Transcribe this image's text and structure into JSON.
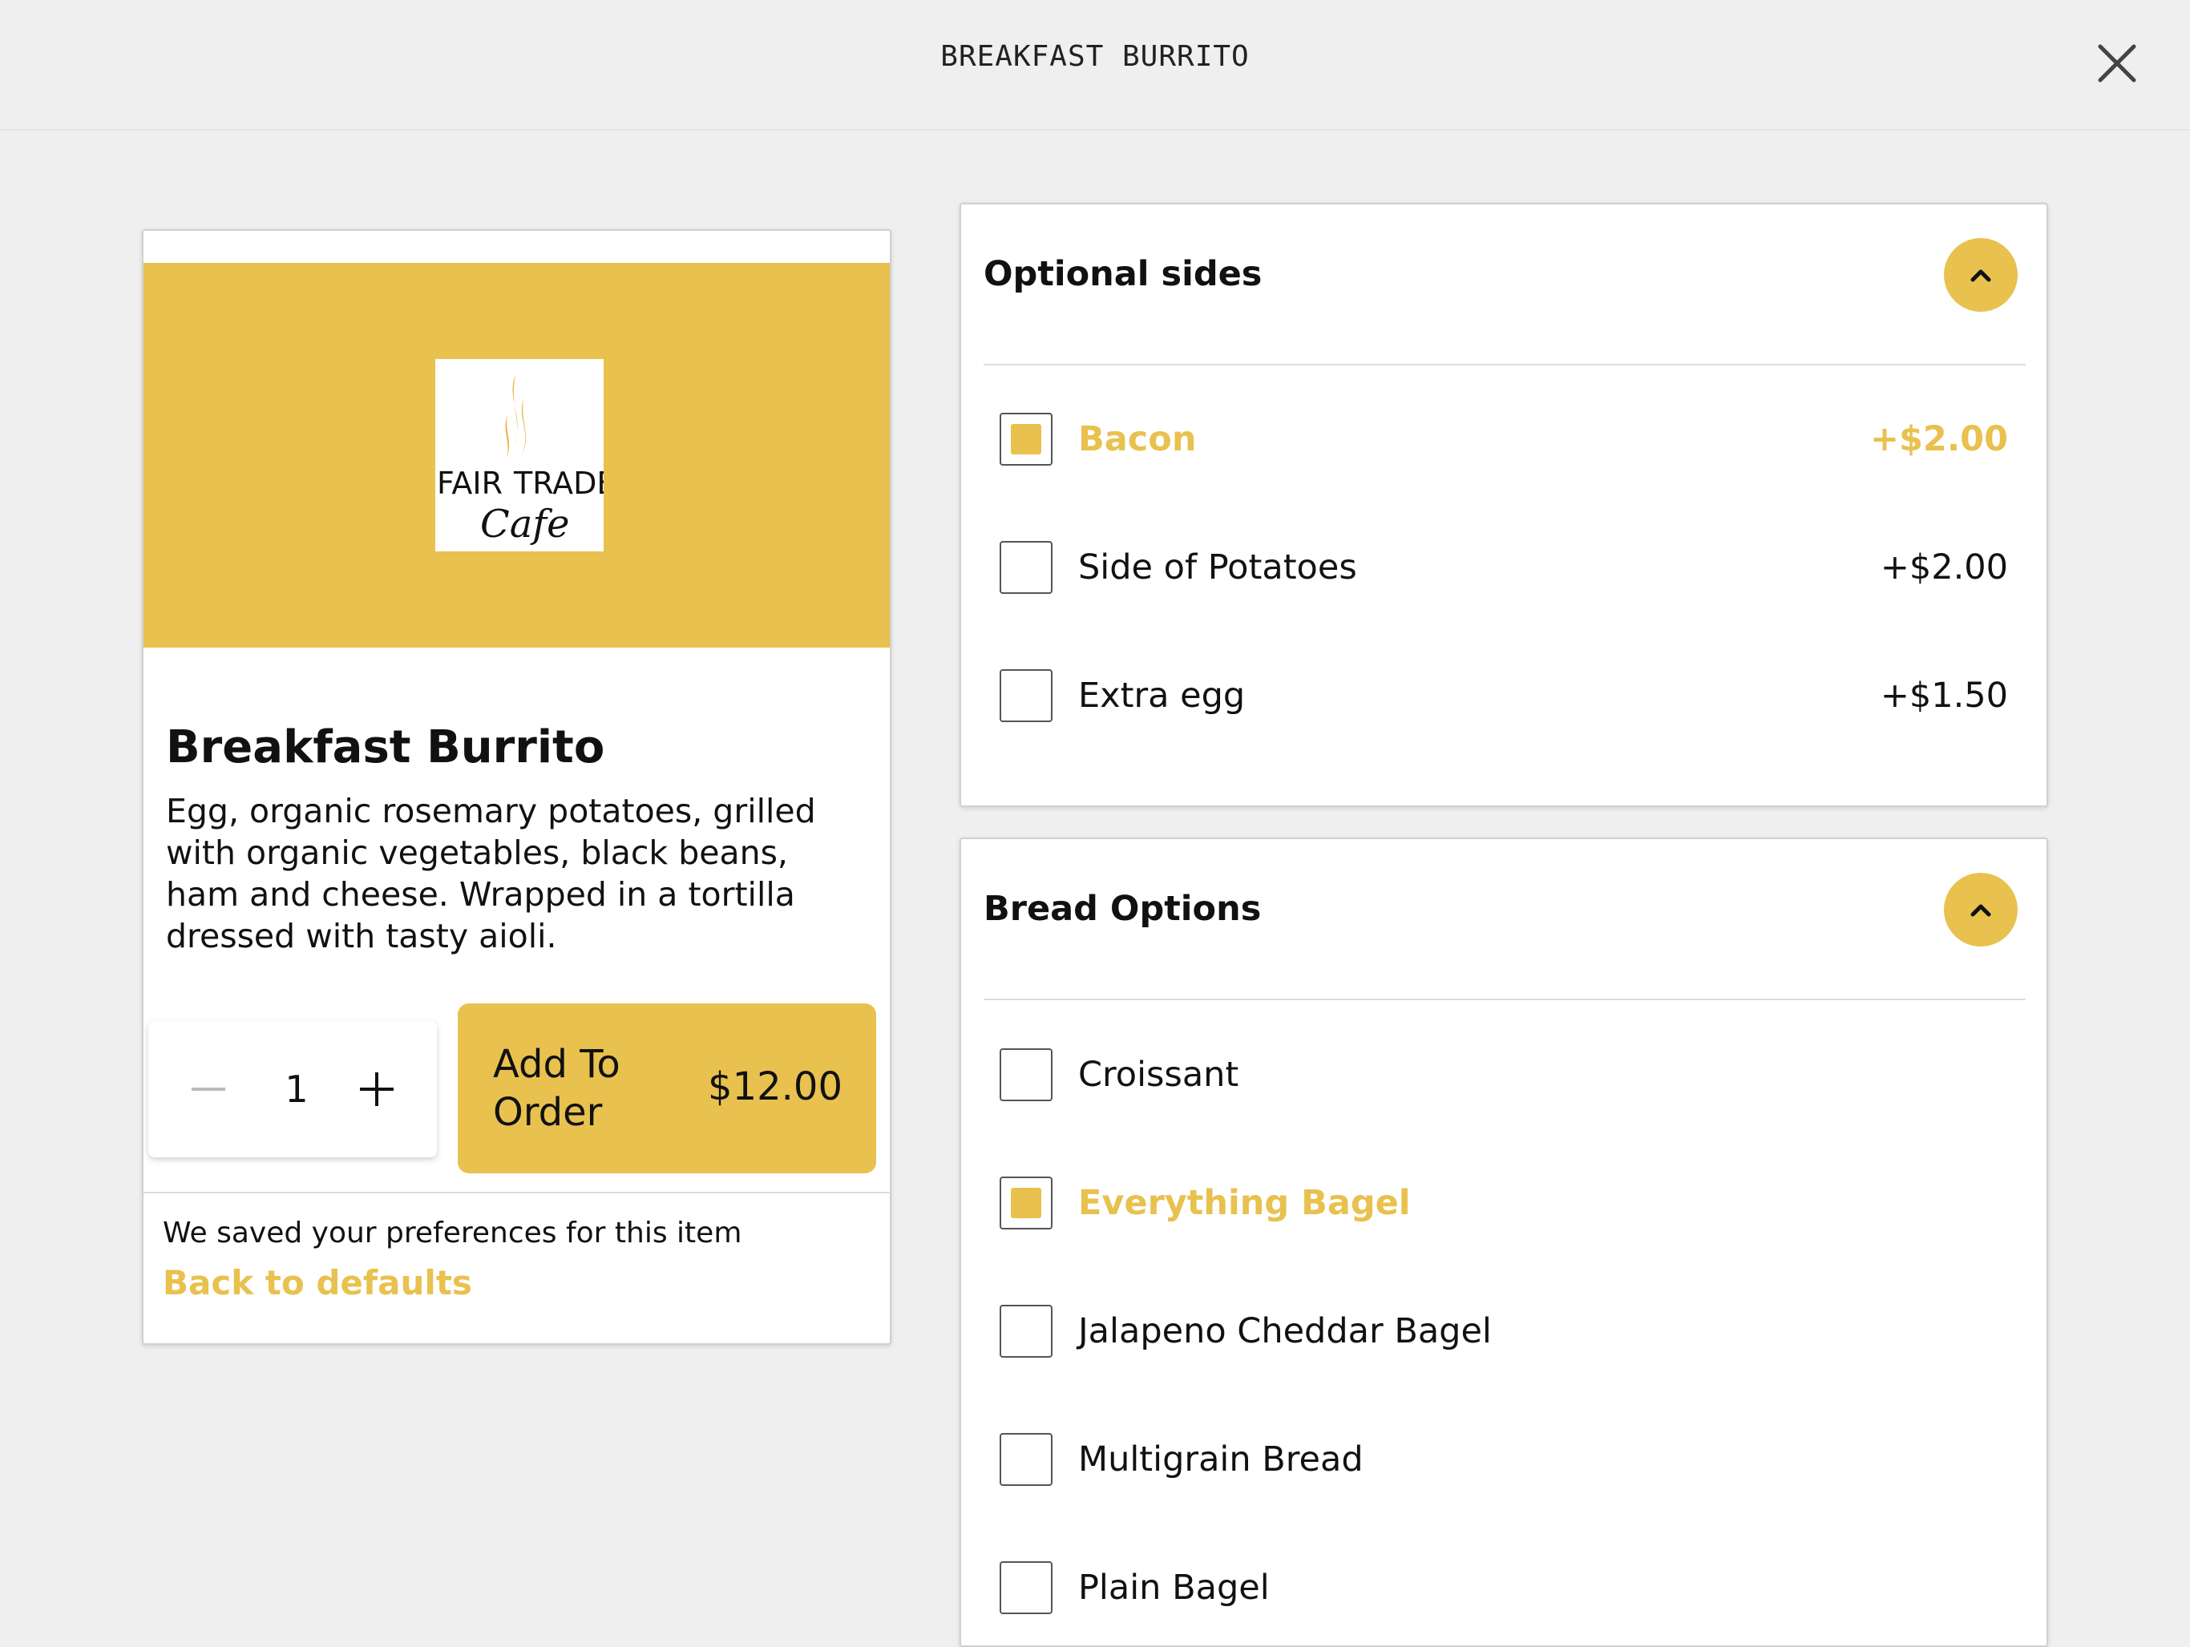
{
  "header": {
    "title": "BREAKFAST BURRITO"
  },
  "item": {
    "logo_text": [
      "FAIR",
      "TRADE",
      "Cafe"
    ],
    "name": "Breakfast Burrito",
    "description": "Egg, organic rosemary potatoes, grilled with organic vegetables, black beans, ham and cheese. Wrapped in a tortilla dressed with tasty aioli.",
    "quantity": "1",
    "add_label": "Add To Order",
    "add_price": "$12.00",
    "saved_text": "We saved your preferences for this item",
    "back_link": "Back to defaults"
  },
  "optional_sides": {
    "title": "Optional sides",
    "options": [
      {
        "label": "Bacon",
        "price": "+$2.00",
        "checked": true
      },
      {
        "label": "Side of Potatoes",
        "price": "+$2.00",
        "checked": false
      },
      {
        "label": "Extra egg",
        "price": "+$1.50",
        "checked": false
      }
    ]
  },
  "bread_options": {
    "title": "Bread Options",
    "options": [
      {
        "label": "Croissant",
        "checked": false
      },
      {
        "label": "Everything Bagel",
        "checked": true
      },
      {
        "label": "Jalapeno Cheddar Bagel",
        "checked": false
      },
      {
        "label": "Multigrain Bread",
        "checked": false
      },
      {
        "label": "Plain Bagel",
        "checked": false
      }
    ]
  },
  "colors": {
    "accent": "#e8c14e",
    "background": "#efefef"
  },
  "icons": {
    "close": "close-icon",
    "minus": "minus-icon",
    "plus": "plus-icon",
    "collapse": "chevron-up-icon"
  }
}
